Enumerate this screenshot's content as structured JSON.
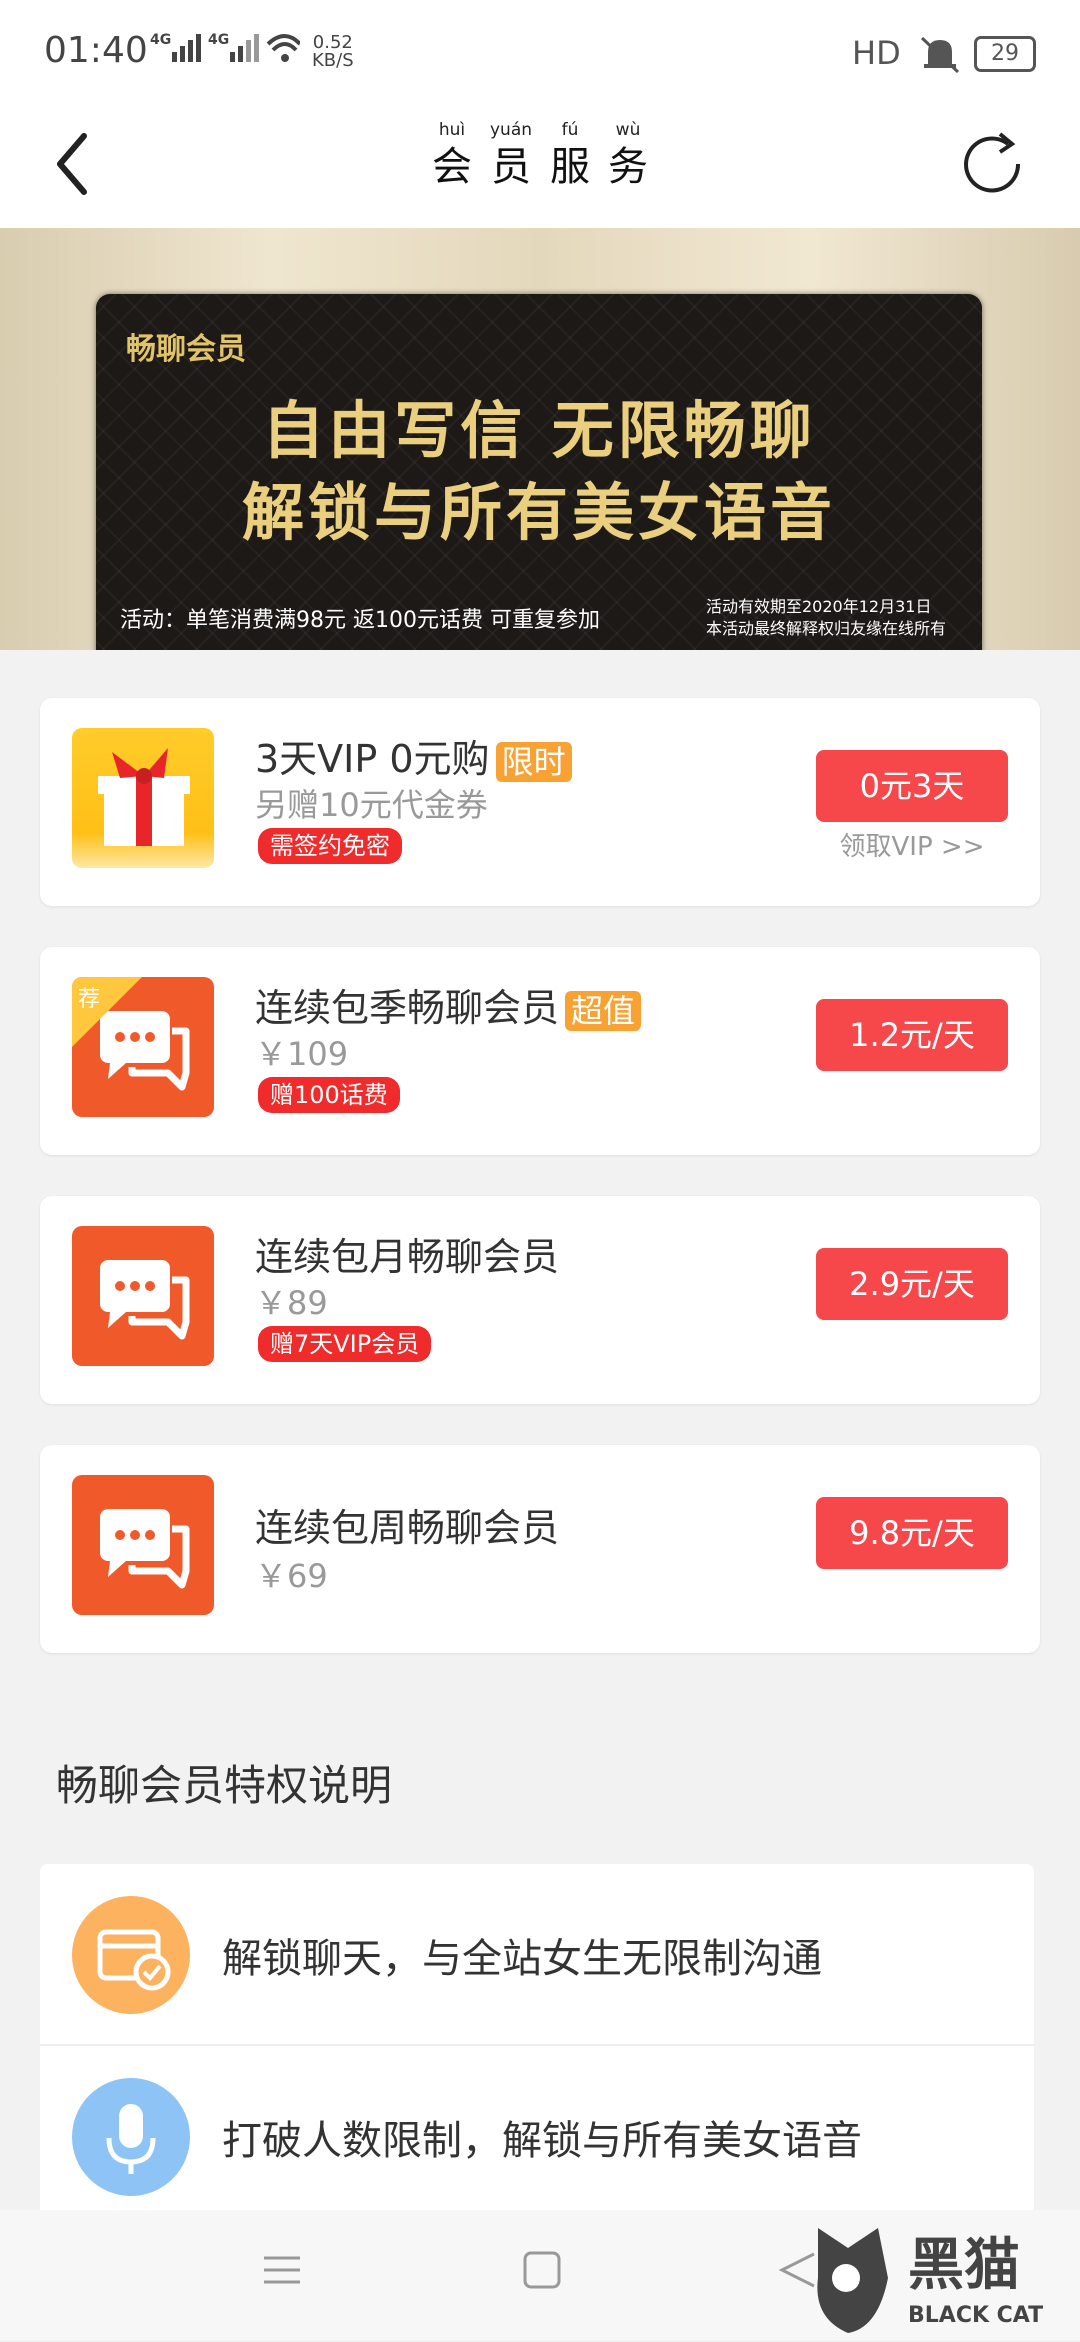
{
  "status_bar": {
    "time": "01:40",
    "signal": "4G 4G",
    "speed_value": "0.52",
    "speed_unit": "KB/S",
    "hd": "HD",
    "battery": "29"
  },
  "nav": {
    "title_chars": [
      "会",
      "员",
      "服",
      "务"
    ],
    "title_pinyin": [
      "huì",
      "yuán",
      "fú",
      "wù"
    ]
  },
  "banner": {
    "label": "畅聊会员",
    "headline1": "自由写信  无限畅聊",
    "headline2": "解锁与所有美女语音",
    "activity": "活动：单笔消费满98元  返100元话费  可重复参加",
    "valid1": "活动有效期至2020年12月31日",
    "valid2": "本活动最终解释权归友缘在线所有"
  },
  "plans": [
    {
      "name": "3天VIP 0元购",
      "tag": "限时",
      "sub": "另赠10元代金券",
      "badge": "需签约免密",
      "button": "0元3天",
      "button_sub": "领取VIP >>"
    },
    {
      "name": "连续包季畅聊会员",
      "tag": "超值",
      "corner": "荐",
      "sub": "￥109",
      "badge": "赠100话费",
      "button": "1.2元/天"
    },
    {
      "name": "连续包月畅聊会员",
      "sub": "￥89",
      "badge": "赠7天VIP会员",
      "button": "2.9元/天"
    },
    {
      "name": "连续包周畅聊会员",
      "sub": "￥69",
      "button": "9.8元/天"
    }
  ],
  "privileges": {
    "title": "畅聊会员特权说明",
    "items": [
      {
        "text": "解锁聊天，与全站女生无限制沟通",
        "color": "#fdb260"
      },
      {
        "text": "打破人数限制，解锁与所有美女语音",
        "color": "#8ec3f5"
      }
    ]
  },
  "watermark": {
    "brand_cn": "黑猫",
    "brand_en": "BLACK CAT"
  },
  "colors": {
    "accent": "#f6474b",
    "tag": "#f8a233",
    "badge": "#f02b2b",
    "icon_orange": "#f05a2a"
  }
}
